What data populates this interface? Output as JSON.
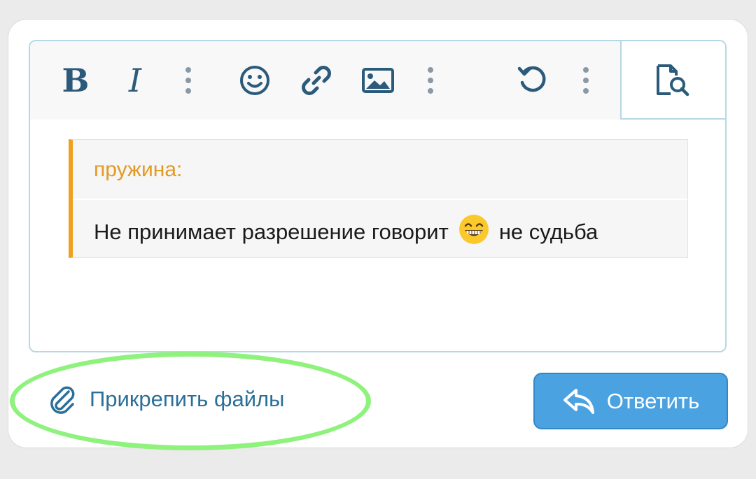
{
  "toolbar": {
    "bold_label": "B",
    "italic_label": "I",
    "icons": [
      "bold-icon",
      "italic-icon",
      "more-icon",
      "emoji-icon",
      "link-icon",
      "image-icon",
      "more-icon",
      "undo-icon",
      "more-icon",
      "preview-icon"
    ]
  },
  "quote": {
    "author": "пружина:",
    "text_before": "Не принимает разрешение говорит",
    "emoji": "grinning-face-icon",
    "text_after": "не судьба"
  },
  "footer": {
    "attach_label": "Прикрепить файлы",
    "reply_label": "Ответить"
  },
  "colors": {
    "accent": "#2b5a7a",
    "quote_bar": "#f0a020",
    "author": "#e39a22",
    "link": "#2b6f99",
    "button": "#4aa2e0",
    "highlight": "#8ef27c"
  }
}
